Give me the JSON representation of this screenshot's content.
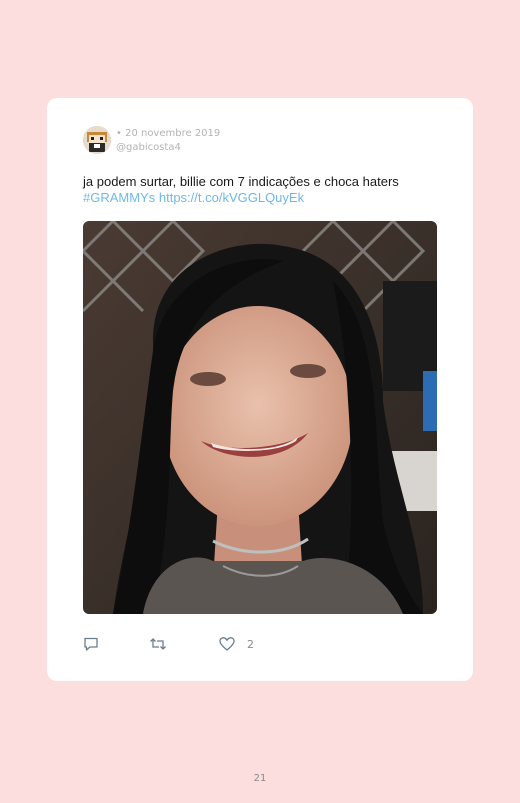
{
  "tweet": {
    "date": "• 20 novembre 2019",
    "handle": "@gabicosta4",
    "text": "ja podem surtar, billie com 7 indicações e choca haters",
    "hashtag": "#GRAMMYs",
    "link": "https://t.co/kVGGLQuyEk",
    "like_count": "2"
  },
  "icons": {
    "reply": "comment-icon",
    "retweet": "retweet-icon",
    "like": "heart-icon"
  },
  "page": {
    "number": "21"
  },
  "colors": {
    "background": "#fddede",
    "card": "#ffffff",
    "link": "#6fb8e8",
    "meta": "#b3b3b3"
  }
}
